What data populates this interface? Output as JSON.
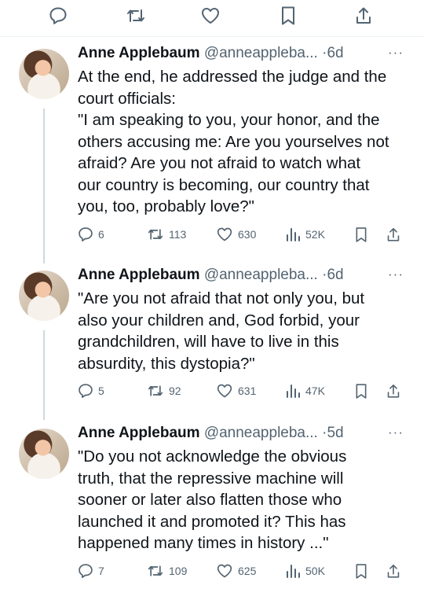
{
  "tweets": [
    {
      "name": "Anne Applebaum",
      "handle": "@anneappleba...",
      "separator": "·",
      "time": "6d",
      "more": "···",
      "lines": [
        "At the end, he addressed the judge and the",
        "court officials:",
        "\"I am speaking to you, your honor, and the",
        "others accusing me: Are you yourselves not",
        "afraid? Are you not afraid to watch what",
        "our country is becoming, our country that",
        "you, too, probably love?\""
      ],
      "replies": "6",
      "retweets": "113",
      "likes": "630",
      "views": "52K"
    },
    {
      "name": "Anne Applebaum",
      "handle": "@anneappleba...",
      "separator": "·",
      "time": "6d",
      "more": "···",
      "lines": [
        "\"Are you not afraid that not only you, but",
        "also your children and, God forbid, your",
        "grandchildren, will have to live in this",
        "absurdity, this dystopia?\""
      ],
      "replies": "5",
      "retweets": "92",
      "likes": "631",
      "views": "47K"
    },
    {
      "name": "Anne Applebaum",
      "handle": "@anneappleba...",
      "separator": "·",
      "time": "5d",
      "more": "···",
      "lines": [
        "\"Do you not acknowledge the obvious",
        "truth, that the repressive machine will",
        "sooner or later also flatten those who",
        "launched it and promoted it? This has",
        "happened many times in history ...\""
      ],
      "replies": "7",
      "retweets": "109",
      "likes": "625",
      "views": "50K"
    }
  ],
  "icons": {
    "reply": "reply-icon",
    "retweet": "retweet-icon",
    "like": "like-icon",
    "views": "views-icon",
    "bookmark": "bookmark-icon",
    "share": "share-icon"
  },
  "colors": {
    "icon": "#536471",
    "text": "#0f1419",
    "thread_line": "#cfd9de"
  }
}
